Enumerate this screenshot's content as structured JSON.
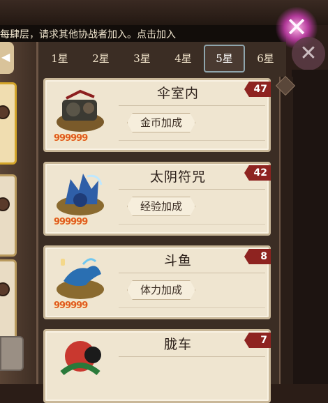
{
  "banner": {
    "text": "每肆层，请求其他协战者加入。点击加入"
  },
  "tabs": [
    {
      "label": "1星"
    },
    {
      "label": "2星"
    },
    {
      "label": "3星"
    },
    {
      "label": "4星"
    },
    {
      "label": "5星",
      "active": true
    },
    {
      "label": "6星"
    }
  ],
  "cards": [
    {
      "name": "伞室内",
      "tag": "金币加成",
      "badge": "47",
      "power": "999999"
    },
    {
      "name": "太阴符咒",
      "tag": "经验加成",
      "badge": "42",
      "power": "999999"
    },
    {
      "name": "斗鱼",
      "tag": "体力加成",
      "badge": "8",
      "power": "999999"
    },
    {
      "name": "胧车",
      "tag": "",
      "badge": "7",
      "power": ""
    }
  ],
  "colors": {
    "badge": "#8e2320",
    "card_bg": "#efe5d0",
    "panel_bg": "#3b2d24",
    "accent_power": "#e05a1f"
  },
  "icons": {
    "close": "close-x-icon",
    "back": "back-arrow-icon"
  }
}
